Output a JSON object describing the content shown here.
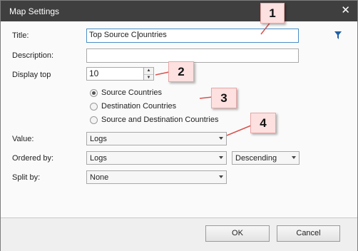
{
  "window": {
    "title": "Map Settings",
    "close_glyph": "✕"
  },
  "form": {
    "title_label": "Title:",
    "title_value": "Top Source Countries",
    "title_value_before_caret": "Top Source C",
    "title_value_after_caret": "ountries",
    "description_label": "Description:",
    "description_value": "",
    "display_top_label": "Display top",
    "display_top_value": "10",
    "radio_options": [
      {
        "label": "Source Countries",
        "selected": true
      },
      {
        "label": "Destination Countries",
        "selected": false
      },
      {
        "label": "Source and Destination Countries",
        "selected": false
      }
    ],
    "value_label": "Value:",
    "value_selected": "Logs",
    "ordered_by_label": "Ordered by:",
    "ordered_by_selected": "Logs",
    "order_direction_selected": "Descending",
    "split_by_label": "Split by:",
    "split_by_selected": "None"
  },
  "buttons": {
    "ok": "OK",
    "cancel": "Cancel"
  },
  "callouts": [
    "1",
    "2",
    "3",
    "4"
  ],
  "icons": {
    "close": "close-icon",
    "filter": "filter-icon",
    "spin_up": "chevron-up-icon",
    "spin_down": "chevron-down-icon"
  },
  "colors": {
    "titlebar": "#3f3f3f",
    "filter_icon": "#1f5fa8",
    "callout_fill": "#fde0e0",
    "callout_border": "#e9a7a7",
    "pointer_line": "#d9534f"
  }
}
